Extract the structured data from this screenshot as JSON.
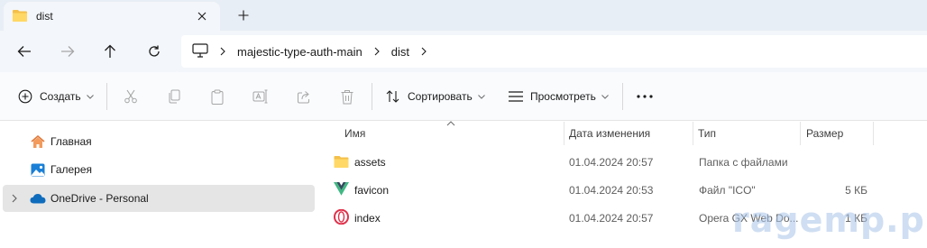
{
  "tab": {
    "title": "dist",
    "icon": "folder-icon",
    "close_glyph": "✕",
    "new_tab_glyph": "+"
  },
  "nav": {
    "back_icon": "arrow-left-icon",
    "forward_icon": "arrow-right-icon",
    "up_icon": "arrow-up-icon",
    "refresh_icon": "refresh-icon",
    "breadcrumbs": [
      "majestic-type-auth-main",
      "dist"
    ]
  },
  "commands": {
    "create_label": "Создать",
    "sort_label": "Сортировать",
    "view_label": "Просмотреть",
    "more_glyph": "•••"
  },
  "sidebar": {
    "items": [
      {
        "label": "Главная",
        "icon": "home-icon"
      },
      {
        "label": "Галерея",
        "icon": "gallery-icon"
      },
      {
        "label": "OneDrive - Personal",
        "icon": "cloud-icon",
        "selected": true
      }
    ]
  },
  "columns": {
    "name": "Имя",
    "date": "Дата изменения",
    "type": "Тип",
    "size": "Размер"
  },
  "files": [
    {
      "name": "assets",
      "date": "01.04.2024 20:57",
      "type": "Папка с файлами",
      "size": "",
      "icon": "folder-icon"
    },
    {
      "name": "favicon",
      "date": "01.04.2024 20:53",
      "type": "Файл \"ICO\"",
      "size": "5 КБ",
      "icon": "vue-logo-icon"
    },
    {
      "name": "index",
      "date": "01.04.2024 20:57",
      "type": "Opera GX Web Do...",
      "size": "1 КБ",
      "icon": "opera-icon"
    }
  ],
  "watermark": "ragemp.pro",
  "colors": {
    "accent": "#0067c0",
    "folder": "#f4c04a",
    "opera": "#e0304a"
  }
}
